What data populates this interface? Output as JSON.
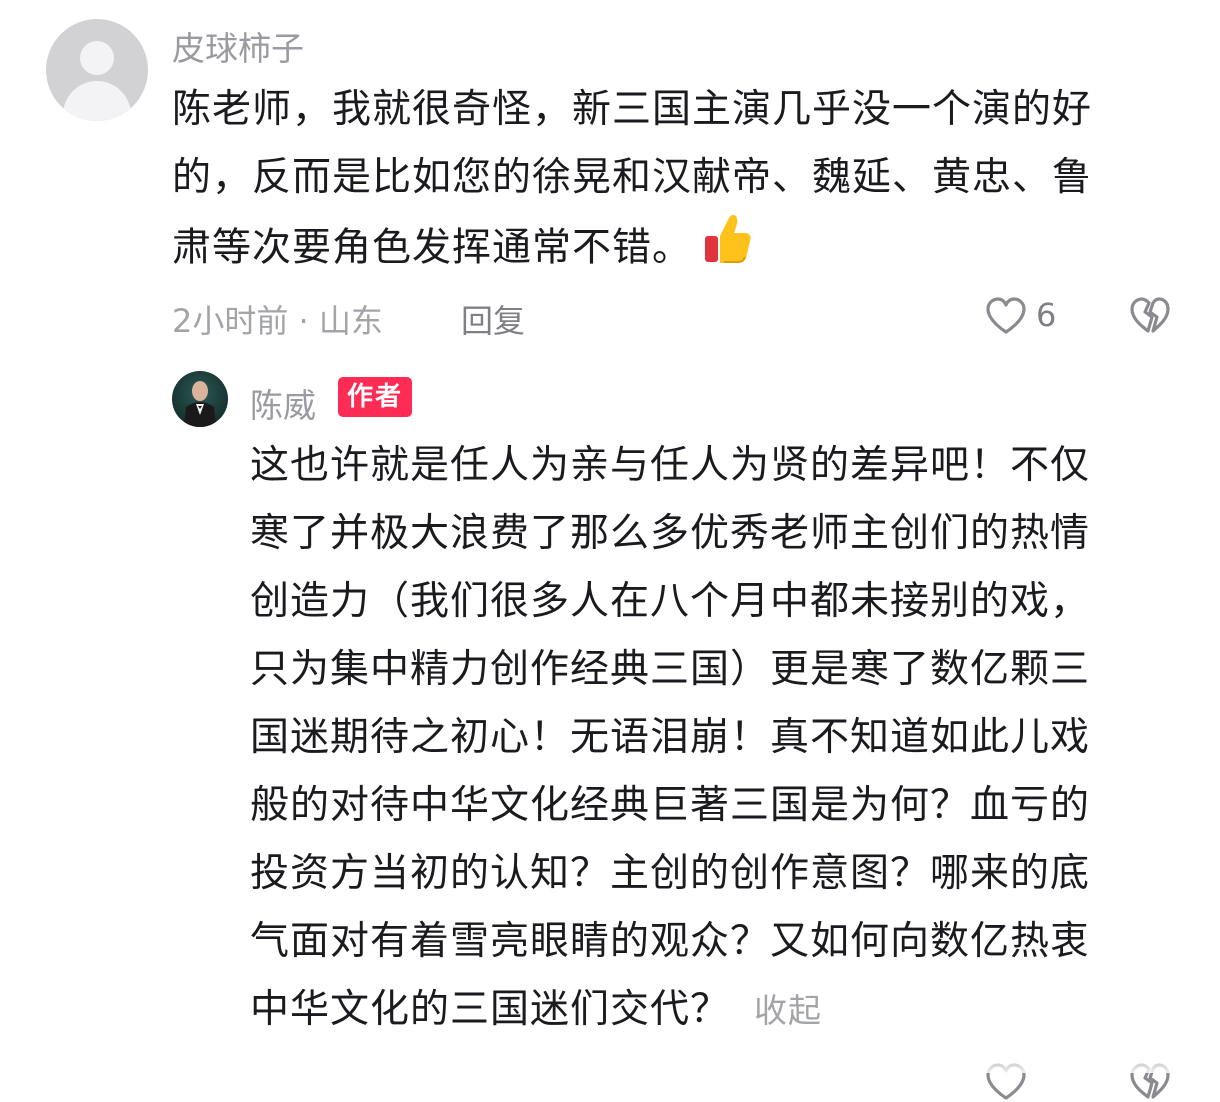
{
  "comment": {
    "username": "皮球柿子",
    "text_lines": [
      "陈老师，我就很奇怪，新三国主演几乎没一个演的好",
      "的，反而是比如您的徐晃和汉献帝、魏延、黄忠、鲁",
      "肃等次要角色发挥通常不错。"
    ],
    "emoji": "thumbs-up",
    "time_location": "2小时前 · 山东",
    "reply_label": "回复",
    "like_count": "6"
  },
  "reply": {
    "username": "陈威",
    "badge": "作者",
    "text_lines": [
      "这也许就是任人为亲与任人为贤的差异吧！不仅",
      "寒了并极大浪费了那么多优秀老师主创们的热情",
      "创造力（我们很多人在八个月中都未接别的戏，",
      "只为集中精力创作经典三国）更是寒了数亿颗三",
      "国迷期待之初心！无语泪崩！真不知道如此儿戏",
      "般的对待中华文化经典巨著三国是为何？血亏的",
      "投资方当初的认知？主创的创作意图？哪来的底",
      "气面对有着雪亮眼睛的观众？又如何向数亿热衷",
      "中华文化的三国迷们交代？"
    ],
    "collapse_label": "收起",
    "accent_color": "#fe2c55"
  },
  "icons": {
    "like": "heart-outline-icon",
    "dislike": "broken-heart-icon",
    "avatar_default": "default-avatar-icon"
  }
}
